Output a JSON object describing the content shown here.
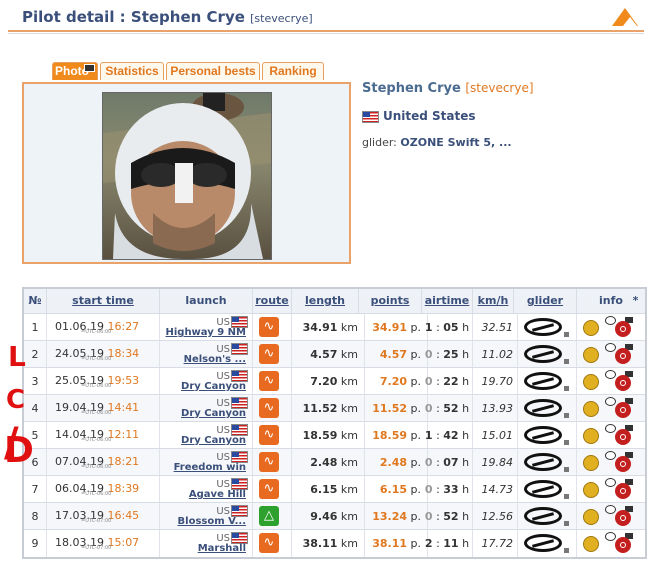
{
  "header": {
    "title": "Pilot detail : Stephen Crye",
    "username": "[stevecrye]"
  },
  "tabs": [
    {
      "label": "Photo",
      "active": true
    },
    {
      "label": "Statistics",
      "active": false
    },
    {
      "label": "Personal bests",
      "active": false
    },
    {
      "label": "Ranking",
      "active": false
    }
  ],
  "pilot": {
    "name": "Stephen Crye",
    "username": "[stevecrye]",
    "country": "United States",
    "glider_label": "glider:",
    "glider": "OZONE Swift 5, ..."
  },
  "table": {
    "headers": [
      "№",
      "start time",
      "launch",
      "route",
      "length",
      "points",
      "airtime",
      "km/h",
      "glider",
      "info",
      "*"
    ],
    "length_unit": "km",
    "points_unit": "p.",
    "airtime_unit": "h",
    "rows": [
      {
        "n": "1",
        "date": "01.06.19",
        "time": "16:27",
        "tz": "UTC-06:00",
        "cc": "US",
        "launch": "Highway 9 NM",
        "route": "open",
        "length": "34.91",
        "points": "34.91",
        "air_h": "1",
        "air_m": "05",
        "speed": "32.51"
      },
      {
        "n": "2",
        "date": "24.05.19",
        "time": "18:34",
        "tz": "UTC-06:00",
        "cc": "US",
        "launch": "Nelson's ...",
        "route": "open",
        "length": "4.57",
        "points": "4.57",
        "air_h": "0",
        "air_m": "25",
        "speed": "11.02"
      },
      {
        "n": "3",
        "date": "25.05.19",
        "time": "19:53",
        "tz": "UTC-06:00",
        "cc": "US",
        "launch": "Dry Canyon",
        "route": "open",
        "length": "7.20",
        "points": "7.20",
        "air_h": "0",
        "air_m": "22",
        "speed": "19.70"
      },
      {
        "n": "4",
        "date": "19.04.19",
        "time": "14:41",
        "tz": "UTC-06:00",
        "cc": "US",
        "launch": "Dry Canyon",
        "route": "open",
        "length": "11.52",
        "points": "11.52",
        "air_h": "0",
        "air_m": "52",
        "speed": "13.93"
      },
      {
        "n": "5",
        "date": "14.04.19",
        "time": "12:11",
        "tz": "UTC-06:00",
        "cc": "US",
        "launch": "Dry Canyon",
        "route": "open",
        "length": "18.59",
        "points": "18.59",
        "air_h": "1",
        "air_m": "42",
        "speed": "15.01"
      },
      {
        "n": "6",
        "date": "07.04.19",
        "time": "18:21",
        "tz": "UTC-06:00",
        "cc": "US",
        "launch": "Freedom win",
        "route": "open",
        "length": "2.48",
        "points": "2.48",
        "air_h": "0",
        "air_m": "07",
        "speed": "19.84"
      },
      {
        "n": "7",
        "date": "06.04.19",
        "time": "18:39",
        "tz": "UTC-06:00",
        "cc": "US",
        "launch": "Agave Hill",
        "route": "open",
        "length": "6.15",
        "points": "6.15",
        "air_h": "0",
        "air_m": "33",
        "speed": "14.73"
      },
      {
        "n": "8",
        "date": "17.03.19",
        "time": "16:45",
        "tz": "UTC-07:00",
        "cc": "US",
        "launch": "Blossom V...",
        "route": "triangle",
        "length": "9.46",
        "points": "13.24",
        "air_h": "0",
        "air_m": "52",
        "speed": "12.56"
      },
      {
        "n": "9",
        "date": "18.03.19",
        "time": "15:07",
        "tz": "UTC-07:00",
        "cc": "US",
        "launch": "Marshall",
        "route": "open",
        "length": "38.11",
        "points": "38.11",
        "air_h": "2",
        "air_m": "11",
        "speed": "17.72"
      }
    ]
  },
  "colors": {
    "accent": "#f08a1c",
    "title": "#3a4f7a",
    "annotation": "#e01010"
  },
  "icons": {
    "route": "route-icon",
    "glider": "glider-logo-icon",
    "info": [
      "gold-medal-icon",
      "comment-icon",
      "camera-icon",
      "magnifier-icon"
    ]
  }
}
